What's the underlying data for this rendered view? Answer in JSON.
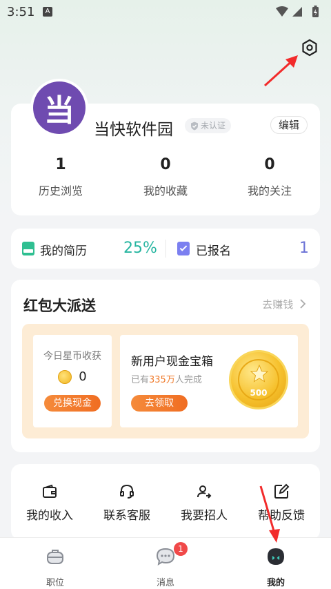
{
  "status_bar": {
    "time": "3:51",
    "notification_icon": "A"
  },
  "profile": {
    "avatar_char": "当",
    "name": "当快软件园",
    "verify_label": "未认证",
    "edit_label": "编辑",
    "stats": [
      {
        "value": "1",
        "label": "历史浏览"
      },
      {
        "value": "0",
        "label": "我的收藏"
      },
      {
        "value": "0",
        "label": "我的关注"
      }
    ]
  },
  "resume": {
    "label": "我的简历",
    "percent": "25%",
    "applied_label": "已报名",
    "applied_count": "1",
    "colors": {
      "percent": "#26b5a0",
      "count": "#6b72d6"
    }
  },
  "hongbao": {
    "title": "红包大派送",
    "more_label": "去赚钱",
    "coin": {
      "title": "今日星币收获",
      "amount": "0",
      "button": "兑换现金"
    },
    "box": {
      "title": "新用户现金宝箱",
      "sub_prefix": "已有",
      "sub_highlight": "335万",
      "sub_suffix": "人完成",
      "button": "去领取",
      "coin_value": "500"
    }
  },
  "services": [
    {
      "label": "我的收入",
      "icon": "wallet-icon"
    },
    {
      "label": "联系客服",
      "icon": "headset-icon"
    },
    {
      "label": "我要招人",
      "icon": "recruit-icon"
    },
    {
      "label": "帮助反馈",
      "icon": "edit-icon"
    }
  ],
  "tabbar": {
    "tabs": [
      {
        "label": "职位",
        "icon": "briefcase-icon"
      },
      {
        "label": "消息",
        "icon": "message-icon",
        "badge": "1"
      },
      {
        "label": "我的",
        "icon": "profile-icon",
        "active": true
      }
    ]
  },
  "colors": {
    "accent_orange": "#f07a2a",
    "arrow_red": "#f22b2b",
    "avatar_purple": "#6f4bb0"
  }
}
